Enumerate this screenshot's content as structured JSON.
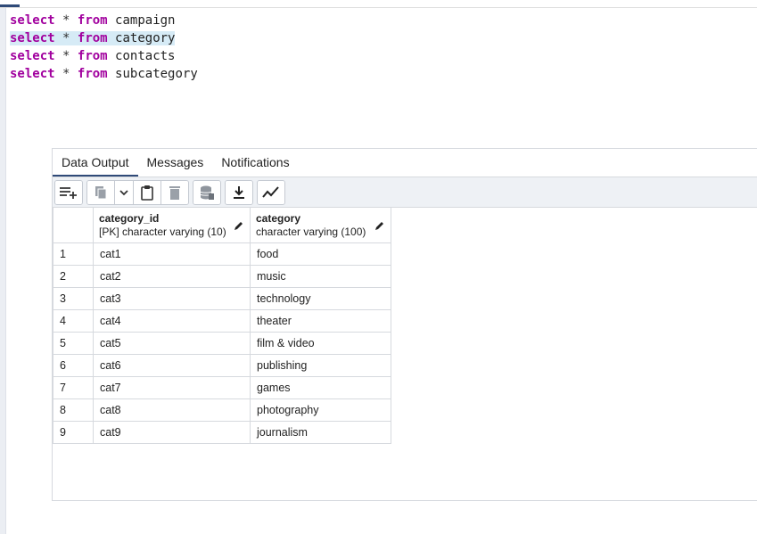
{
  "editor": {
    "lines": [
      {
        "kw1": "select",
        "op": "*",
        "kw2": "from",
        "table": "campaign"
      },
      {
        "kw1": "select",
        "op": "*",
        "kw2": "from",
        "table": "category"
      },
      {
        "kw1": "select",
        "op": "*",
        "kw2": "from",
        "table": "contacts"
      },
      {
        "kw1": "select",
        "op": "*",
        "kw2": "from",
        "table": "subcategory"
      }
    ],
    "highlighted_line": 2
  },
  "tabs": [
    {
      "label": "Data Output",
      "active": true
    },
    {
      "label": "Messages",
      "active": false
    },
    {
      "label": "Notifications",
      "active": false
    }
  ],
  "toolbar": {
    "icons": [
      "add-row-icon",
      "copy-icon",
      "chevron-down-icon",
      "paste-icon",
      "delete-icon",
      "save-data-icon",
      "download-icon",
      "graph-icon"
    ]
  },
  "grid": {
    "columns": [
      {
        "name": "category_id",
        "type": "[PK] character varying (10)"
      },
      {
        "name": "category",
        "type": "character varying (100)"
      }
    ],
    "rows": [
      {
        "n": "1",
        "id": "cat1",
        "category": "food"
      },
      {
        "n": "2",
        "id": "cat2",
        "category": "music"
      },
      {
        "n": "3",
        "id": "cat3",
        "category": "technology"
      },
      {
        "n": "4",
        "id": "cat4",
        "category": "theater"
      },
      {
        "n": "5",
        "id": "cat5",
        "category": "film & video"
      },
      {
        "n": "6",
        "id": "cat6",
        "category": "publishing"
      },
      {
        "n": "7",
        "id": "cat7",
        "category": "games"
      },
      {
        "n": "8",
        "id": "cat8",
        "category": "photography"
      },
      {
        "n": "9",
        "id": "cat9",
        "category": "journalism"
      }
    ]
  },
  "colors": {
    "keyword": "#a1009e",
    "highlight": "#d6ebf6",
    "accent": "#2f4a78"
  }
}
